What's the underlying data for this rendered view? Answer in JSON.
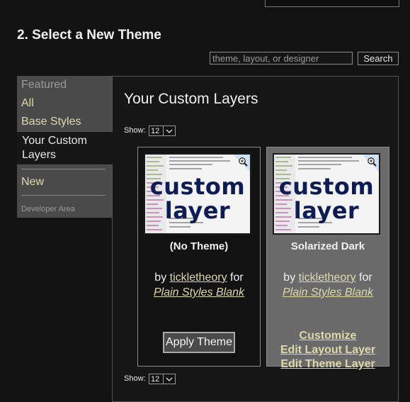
{
  "heading": "2. Select a New Theme",
  "search": {
    "placeholder": "theme, layout, or designer",
    "button": "Search"
  },
  "sidebar": {
    "items": [
      {
        "label": "Featured"
      },
      {
        "label": "All"
      },
      {
        "label": "Base Styles"
      },
      {
        "label": "Your Custom Layers"
      },
      {
        "label": "New"
      },
      {
        "label": "Developer Area"
      }
    ]
  },
  "main": {
    "title": "Your Custom Layers",
    "show_label": "Show:",
    "show_value": "12"
  },
  "cards": [
    {
      "thumb_line1": "custom",
      "thumb_line2": "layer",
      "name": "(No Theme)",
      "by": "by",
      "author": "tickletheory",
      "for": "for",
      "layout": "Plain Styles Blank",
      "apply": "Apply Theme"
    },
    {
      "thumb_line1": "custom",
      "thumb_line2": "layer",
      "name": "Solarized Dark",
      "by": "by",
      "author": "tickletheory",
      "for": "for",
      "layout": "Plain Styles Blank",
      "links": [
        "Customize",
        "Edit Layout Layer",
        "Edit Theme Layer"
      ]
    }
  ],
  "colors": {
    "link": "#ddd9a8",
    "sidebar_bg": "#4a4a4a",
    "page_bg": "#121212",
    "thumb_text": "#0d1c55"
  }
}
